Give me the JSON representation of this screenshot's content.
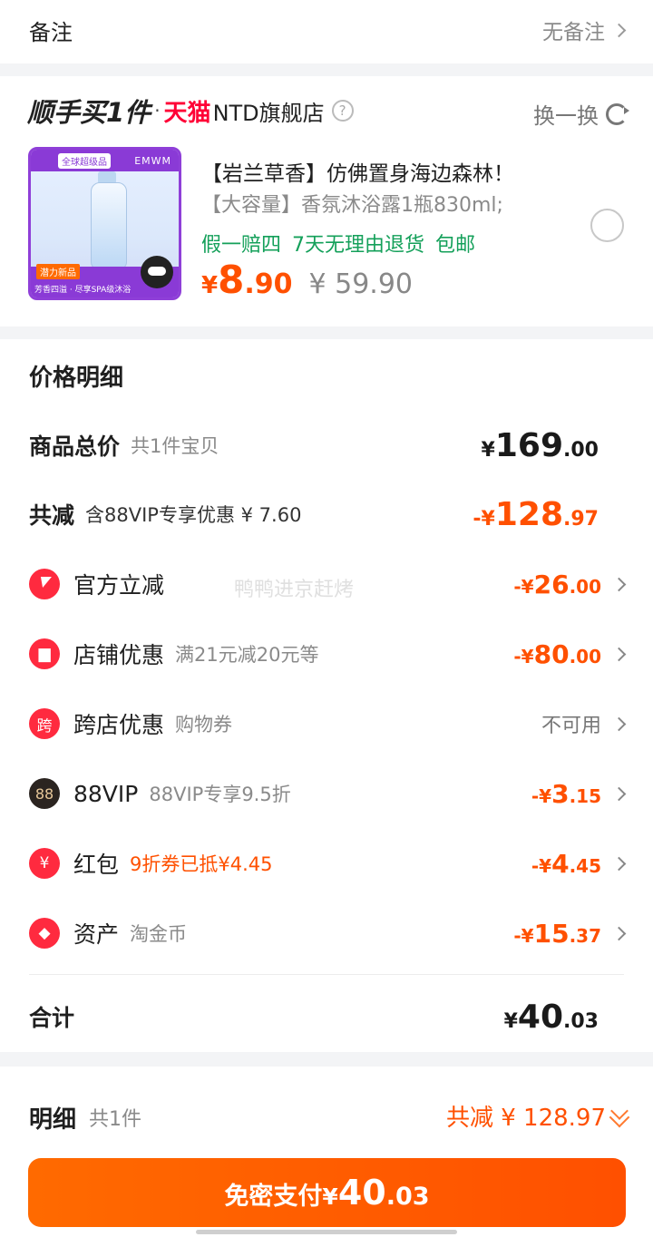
{
  "note": {
    "label": "备注",
    "value": "无备注"
  },
  "promo": {
    "title": "顺手买1件",
    "dot": "·",
    "platform": "天猫",
    "store": "NTD旗舰店",
    "help_icon": "question-circle-icon",
    "swap_label": "换一换",
    "product": {
      "image_badge": "全球超级品",
      "image_brand": "EMWM",
      "image_tag": "潜力新品",
      "image_foot": "芳香四溢 · 尽享SPA级沐浴",
      "title": "【岩兰草香】仿佛置身海边森林！",
      "subtitle": "【大容量】香氛沐浴露1瓶830ml;",
      "tags": [
        "假一赔四",
        "7天无理由退货",
        "包邮"
      ],
      "price_symbol": "¥",
      "price_int": "8",
      "price_dec": ".90",
      "original_price": "¥ 59.90",
      "selected": false
    }
  },
  "detail": {
    "title": "价格明细",
    "watermark": "鸭鸭进京赶烤",
    "total_goods": {
      "label": "商品总价",
      "sub": "共1件宝贝",
      "sym": "¥",
      "int": "169",
      "dec": ".00"
    },
    "total_off": {
      "label": "共减",
      "sub": "含88VIP专享优惠 ¥ 7.60",
      "sym": "-¥",
      "int": "128",
      "dec": ".97"
    },
    "items": [
      {
        "icon": "lightning-icon",
        "label": "官方立减",
        "sub": "",
        "sym": "-¥",
        "int": "26",
        "dec": ".00"
      },
      {
        "icon": "shop-icon",
        "label": "店铺优惠",
        "sub": "满21元减20元等",
        "sym": "-¥",
        "int": "80",
        "dec": ".00"
      },
      {
        "icon": "cross-store-icon",
        "icon_text": "跨",
        "label": "跨店优惠",
        "sub": "购物券",
        "value_text": "不可用"
      },
      {
        "icon": "vip88-icon",
        "icon_text": "88",
        "label": "88VIP",
        "sub": "88VIP专享9.5折",
        "sym": "-¥",
        "int": "3",
        "dec": ".15"
      },
      {
        "icon": "red-packet-icon",
        "icon_text": "¥",
        "label": "红包",
        "sub": "9折券已抵¥4.45",
        "sym": "-¥",
        "int": "4",
        "dec": ".45"
      },
      {
        "icon": "tag-icon",
        "label": "资产",
        "sub": "淘金币",
        "sym": "-¥",
        "int": "15",
        "dec": ".37"
      }
    ],
    "sum": {
      "label": "合计",
      "sym": "¥",
      "int": "40",
      "dec": ".03"
    }
  },
  "bottom": {
    "label": "明细",
    "sub": "共1件",
    "total_off": "共减 ¥ 128.97",
    "pay": {
      "text": "免密支付",
      "sym": "¥",
      "int": "40",
      "dec": ".03"
    }
  },
  "colors": {
    "accent": "#ff5000",
    "green": "#14a05a",
    "tmall": "#ff0036",
    "badge_red": "#ff2a3f"
  }
}
